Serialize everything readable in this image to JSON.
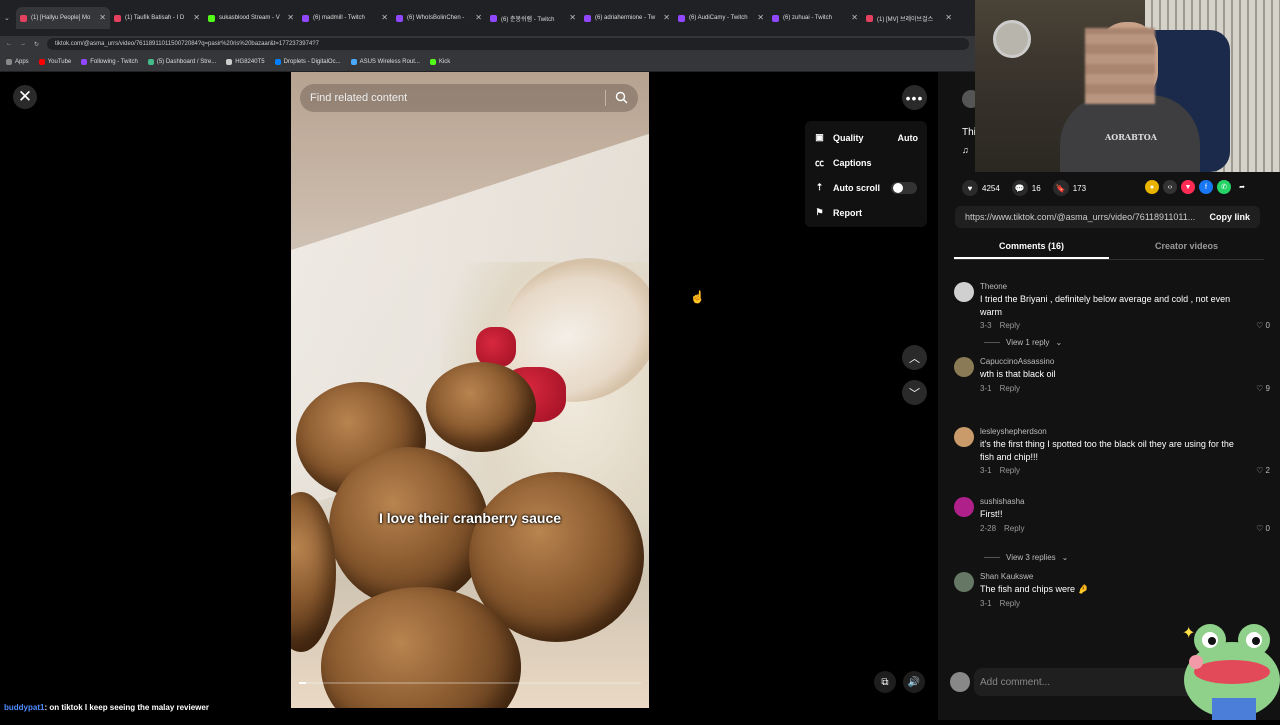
{
  "browser": {
    "tabs": [
      {
        "title": "(1) [Hallyu People] Mo",
        "color": "#e4405f"
      },
      {
        "title": "(1) Taufik Batisah - I D",
        "color": "#e4405f"
      },
      {
        "title": "sukasblood Stream - V",
        "color": "#53fc18"
      },
      {
        "title": "(6) madmill - Twitch",
        "color": "#9146ff"
      },
      {
        "title": "(6) WhoIsBolinChen -",
        "color": "#9146ff"
      },
      {
        "title": "(6) 춘봉쉬램 - Twitch",
        "color": "#9146ff"
      },
      {
        "title": "(6) adriahermione - Tw",
        "color": "#9146ff"
      },
      {
        "title": "(6) AudiCamy - Twitch",
        "color": "#9146ff"
      },
      {
        "title": "(6) zuhuai - Twitch",
        "color": "#9146ff"
      },
      {
        "title": "(1) [MV] 브레이브걸스",
        "color": "#e4405f"
      }
    ],
    "url": "tiktok.com/@asma_urrs/video/7611891101150072084?q=pasir%20ris%20bazaar&t=1772373974?7",
    "bookmarks": [
      {
        "label": "Apps",
        "color": "#888888"
      },
      {
        "label": "YouTube",
        "color": "#ff0000"
      },
      {
        "label": "Following - Twitch",
        "color": "#9146ff"
      },
      {
        "label": "(5) Dashboard / Stre...",
        "color": "#44bb88"
      },
      {
        "label": "HG8240T5",
        "color": "#cccccc"
      },
      {
        "label": "Droplets - DigitalOc...",
        "color": "#0080ff"
      },
      {
        "label": "ASUS Wireless Rout...",
        "color": "#4aa8ff"
      },
      {
        "label": "Kick",
        "color": "#53fc18"
      }
    ]
  },
  "video": {
    "search_placeholder": "Find related content",
    "caption": "I love their cranberry sauce",
    "progress_fraction": 0.02
  },
  "menu": {
    "items": [
      {
        "label": "Quality",
        "value": "Auto",
        "icon": "quality-icon"
      },
      {
        "label": "Captions",
        "value": "",
        "icon": "captions-icon"
      },
      {
        "label": "Auto scroll",
        "value": "",
        "icon": "auto-scroll-icon",
        "toggle": false
      },
      {
        "label": "Report",
        "value": "",
        "icon": "flag-icon"
      }
    ]
  },
  "post": {
    "desc_snip": "Thi",
    "likes": "4254",
    "comments": "16",
    "saves": "173",
    "link": "https://www.tiktok.com/@asma_urrs/video/76118911011...",
    "copy_label": "Copy link"
  },
  "tabs": {
    "comments": "Comments (16)",
    "creator": "Creator videos"
  },
  "comments": [
    {
      "user": "Theone",
      "text": "I tried the Briyani , definitely below average and cold , not even warm",
      "date": "3-3",
      "reply": "Reply",
      "likes": "0",
      "view": "View 1 reply",
      "avatar": "#d0d0d0"
    },
    {
      "user": "CapuccinoAssassino",
      "text": "wth is that black oil",
      "date": "3-1",
      "reply": "Reply",
      "likes": "9",
      "view": "",
      "avatar": "#8a7a55"
    },
    {
      "user": "lesleyshepherdson",
      "text": "it's the first thing I spotted too the black oil they are using for the fish and chip!!!",
      "date": "3-1",
      "reply": "Reply",
      "likes": "2",
      "view": "",
      "avatar": "#c99a6a"
    },
    {
      "user": "sushishasha",
      "text": "First!!",
      "date": "2-28",
      "reply": "Reply",
      "likes": "0",
      "view": "View 3 replies",
      "avatar": "#b0208a"
    },
    {
      "user": "Shan Kaukswe",
      "text": "The fish and chips were 🤌",
      "date": "3-1",
      "reply": "Reply",
      "likes": "",
      "view": "",
      "avatar": "#667766"
    }
  ],
  "add_comment": "Add comment...",
  "webcam": {
    "shirt_text": "AORABTOA"
  },
  "chat": {
    "name": "buddypat1",
    "message": ": on tiktok I keep seeing the malay reviewer"
  }
}
